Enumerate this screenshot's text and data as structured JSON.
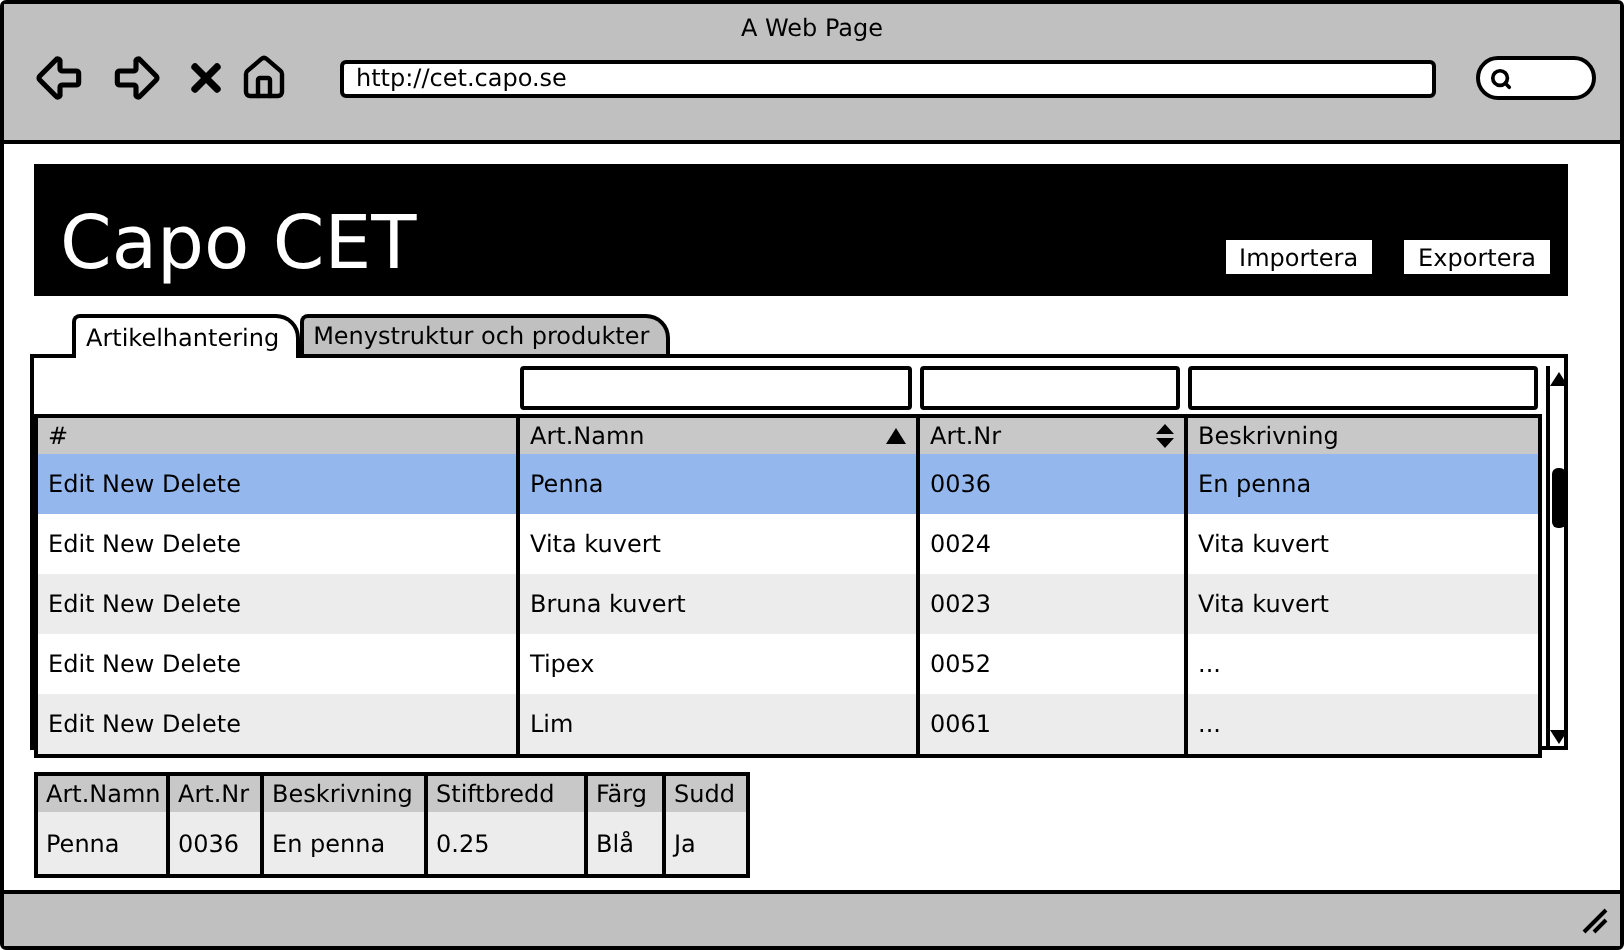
{
  "window": {
    "title": "A Web Page",
    "url": "http://cet.capo.se"
  },
  "header": {
    "title": "Capo CET",
    "buttons": [
      "Importera",
      "Exportera"
    ]
  },
  "tabs": [
    {
      "label": "Artikelhantering",
      "selected": true
    },
    {
      "label": "Menystruktur och produkter",
      "selected": false
    }
  ],
  "table": {
    "columns": [
      {
        "label": "#",
        "filter_field": false,
        "sortable": false,
        "sorted": false
      },
      {
        "label": "Art.Namn",
        "filter_field": true,
        "sortable": true,
        "sorted": true
      },
      {
        "label": "Art.Nr",
        "filter_field": true,
        "sortable": true,
        "sorted": false
      },
      {
        "label": "Beskrivning",
        "filter_field": true,
        "sortable": false,
        "sorted": false
      }
    ],
    "rows": [
      {
        "cells": [
          "Edit New Delete",
          "Penna",
          "0036",
          "En penna"
        ],
        "selected": true
      },
      {
        "cells": [
          "Edit New Delete",
          "Vita kuvert",
          "0024",
          "Vita kuvert"
        ],
        "selected": false
      },
      {
        "cells": [
          "Edit New Delete",
          "Bruna kuvert",
          "0023",
          "Vita kuvert"
        ],
        "selected": false
      },
      {
        "cells": [
          "Edit New Delete",
          "Tipex",
          "0052",
          "..."
        ],
        "selected": false
      },
      {
        "cells": [
          "Edit New Delete",
          "Lim",
          "0061",
          "..."
        ],
        "selected": false
      }
    ]
  },
  "details": {
    "columns": [
      "Art.Namn",
      "Art.Nr",
      "Beskrivning",
      "Stiftbredd",
      "Färg",
      "Sudd"
    ],
    "values": [
      "Penna",
      "0036",
      "En penna",
      "0.25",
      "Blå",
      "Ja"
    ]
  }
}
